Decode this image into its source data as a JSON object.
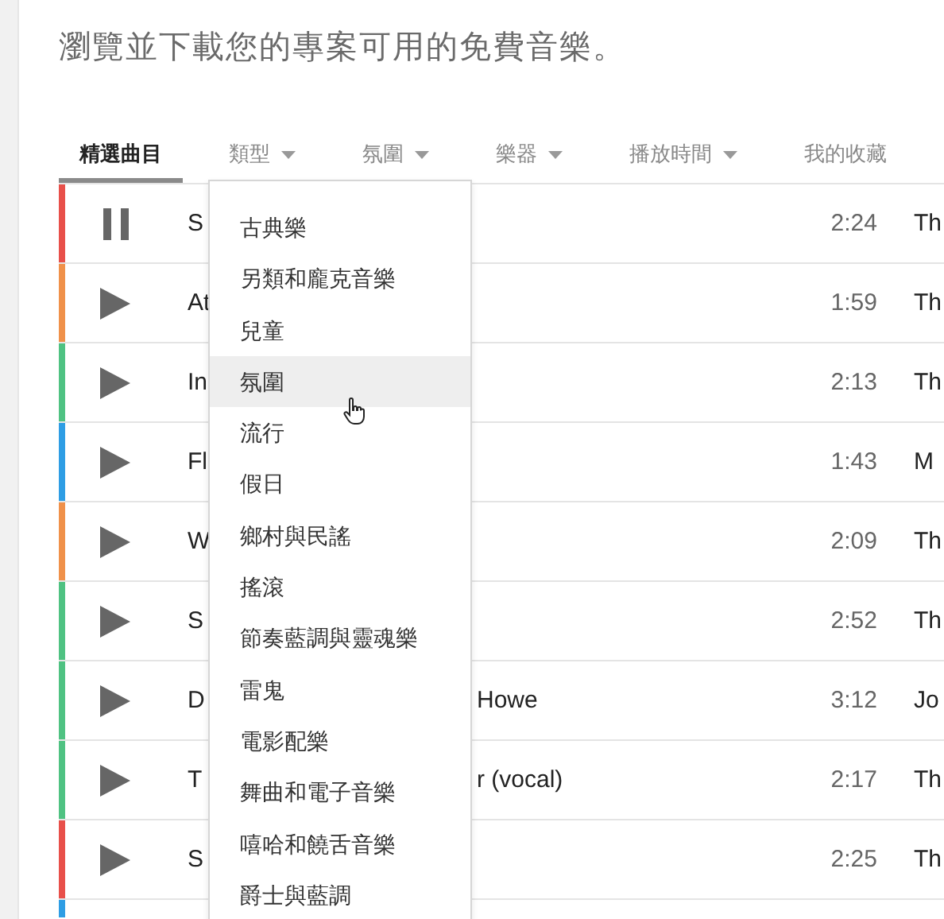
{
  "heading": "瀏覽並下載您的專案可用的免費音樂。",
  "tabs": [
    {
      "label": "精選曲目",
      "selected": true,
      "has_menu": false
    },
    {
      "label": "類型",
      "selected": false,
      "has_menu": true
    },
    {
      "label": "氛圍",
      "selected": false,
      "has_menu": true
    },
    {
      "label": "樂器",
      "selected": false,
      "has_menu": true
    },
    {
      "label": "播放時間",
      "selected": false,
      "has_menu": true
    },
    {
      "label": "我的收藏",
      "selected": false,
      "has_menu": false
    }
  ],
  "tracks": [
    {
      "color": "#e8504a",
      "playing": true,
      "title": "S",
      "duration": "2:24",
      "artist": "Th"
    },
    {
      "color": "#f0914a",
      "playing": false,
      "title": "At",
      "duration": "1:59",
      "artist": "Th"
    },
    {
      "color": "#4fc282",
      "playing": false,
      "title": "In",
      "duration": "2:13",
      "artist": "Th"
    },
    {
      "color": "#2e9de4",
      "playing": false,
      "title": "Fl",
      "duration": "1:43",
      "artist": "M"
    },
    {
      "color": "#f0914a",
      "playing": false,
      "title": "W",
      "duration": "2:09",
      "artist": "Th"
    },
    {
      "color": "#4fc282",
      "playing": false,
      "title": "S",
      "duration": "2:52",
      "artist": "Th"
    },
    {
      "color": "#4fc282",
      "playing": false,
      "title": "D",
      "title_tail": "Howe",
      "duration": "3:12",
      "artist": "Jo"
    },
    {
      "color": "#4fc282",
      "playing": false,
      "title": "T",
      "title_tail": "r (vocal)",
      "duration": "2:17",
      "artist": "Th"
    },
    {
      "color": "#e8504a",
      "playing": false,
      "title": "S",
      "duration": "2:25",
      "artist": "Th"
    },
    {
      "color": "#2e9de4"
    }
  ],
  "genre_menu": {
    "items": [
      {
        "label": "古典樂",
        "highlighted": false
      },
      {
        "label": "另類和龐克音樂",
        "highlighted": false
      },
      {
        "label": "兒童",
        "highlighted": false
      },
      {
        "label": "氛圍",
        "highlighted": true
      },
      {
        "label": "流行",
        "highlighted": false
      },
      {
        "label": "假日",
        "highlighted": false
      },
      {
        "label": "鄉村與民謠",
        "highlighted": false
      },
      {
        "label": "搖滾",
        "highlighted": false
      },
      {
        "label": "節奏藍調與靈魂樂",
        "highlighted": false
      },
      {
        "label": "雷鬼",
        "highlighted": false
      },
      {
        "label": "電影配樂",
        "highlighted": false
      },
      {
        "label": "舞曲和電子音樂",
        "highlighted": false
      },
      {
        "label": "嘻哈和饒舌音樂",
        "highlighted": false
      },
      {
        "label": "爵士與藍調",
        "highlighted": false
      }
    ]
  }
}
